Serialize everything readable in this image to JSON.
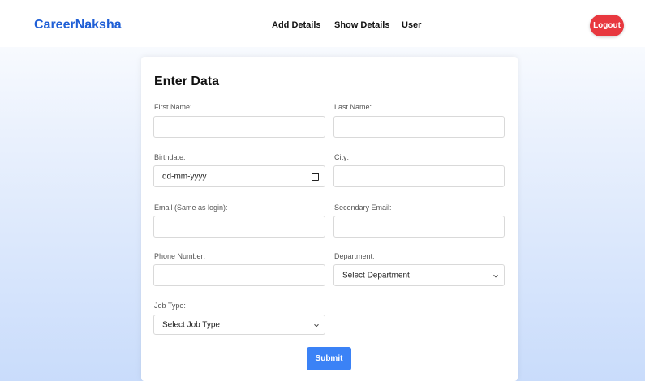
{
  "navbar": {
    "brand": "CareerNaksha",
    "links": [
      "Add Details",
      "Show Details",
      "User"
    ],
    "logout_label": "Logout"
  },
  "colors": {
    "brand": "#1f5fd6",
    "logout": "#e8383f",
    "submit": "#3b82f6"
  },
  "form": {
    "title": "Enter Data",
    "first_name_label": "First Name:",
    "last_name_label": "Last Name:",
    "birthdate_label": "Birthdate:",
    "birthdate_placeholder": "dd-mm-yyyy",
    "city_label": "City:",
    "email_label": "Email (Same as login):",
    "secondary_email_label": "Secondary Email:",
    "phone_label": "Phone Number:",
    "department_label": "Department:",
    "department_selected": "Select Department",
    "job_type_label": "Job Type:",
    "job_type_selected": "Select Job Type",
    "submit_label": "Submit"
  },
  "icons": {
    "date_picker": "calendar-icon",
    "dropdown": "chevron-down-icon"
  }
}
